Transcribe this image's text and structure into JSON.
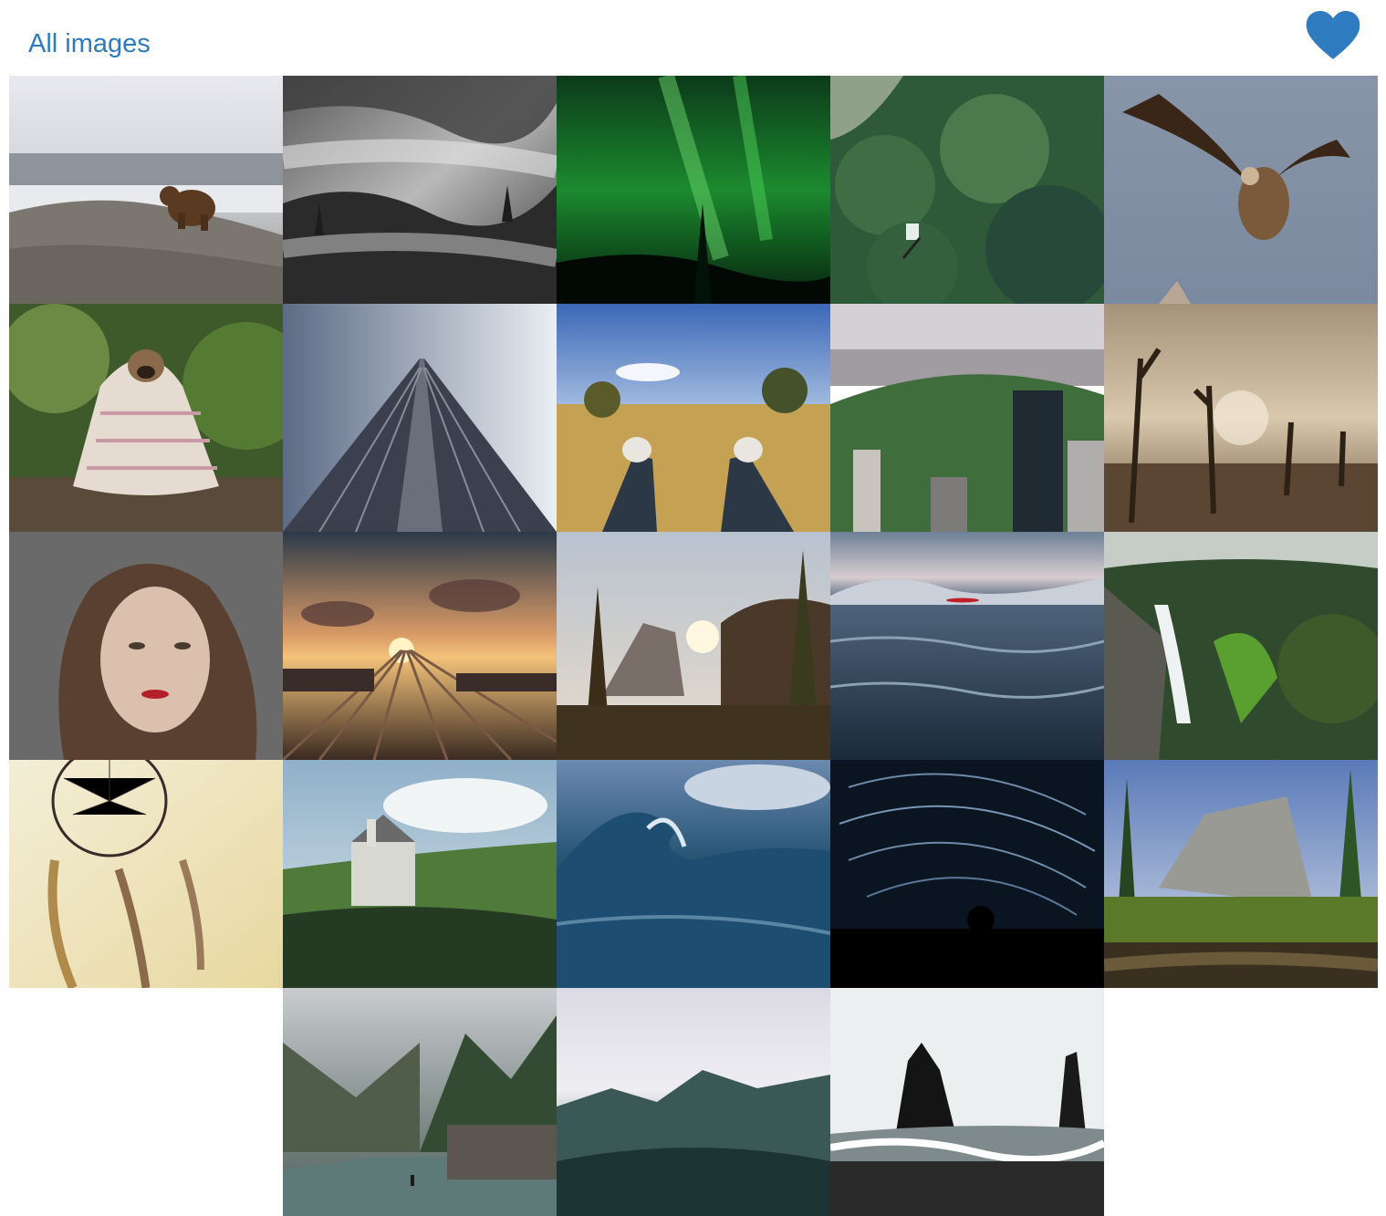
{
  "header": {
    "title": "All images",
    "favorites_icon": "heart-icon"
  },
  "colors": {
    "accent": "#2f7bc0",
    "background": "#ffffff"
  },
  "gallery": {
    "columns": 5,
    "rows": 5,
    "images": [
      {
        "subject": "bear",
        "row": 1,
        "col": 1
      },
      {
        "subject": "foggy-forest",
        "row": 1,
        "col": 2
      },
      {
        "subject": "aurora",
        "row": 1,
        "col": 3
      },
      {
        "subject": "mountain-biker",
        "row": 1,
        "col": 4
      },
      {
        "subject": "vulture",
        "row": 1,
        "col": 5
      },
      {
        "subject": "pug-in-blanket",
        "row": 2,
        "col": 1
      },
      {
        "subject": "skyscraper",
        "row": 2,
        "col": 2
      },
      {
        "subject": "sneakers-field",
        "row": 2,
        "col": 3
      },
      {
        "subject": "central-park",
        "row": 2,
        "col": 4
      },
      {
        "subject": "dead-trees",
        "row": 2,
        "col": 5
      },
      {
        "subject": "woman-portrait",
        "row": 3,
        "col": 1
      },
      {
        "subject": "rail-yard-sunset",
        "row": 3,
        "col": 2
      },
      {
        "subject": "half-dome-sunrise",
        "row": 3,
        "col": 3
      },
      {
        "subject": "lake-kayak",
        "row": 3,
        "col": 4
      },
      {
        "subject": "waterfall",
        "row": 3,
        "col": 5
      },
      {
        "subject": "dreamcatcher",
        "row": 4,
        "col": 1
      },
      {
        "subject": "castle",
        "row": 4,
        "col": 2
      },
      {
        "subject": "ocean-wave",
        "row": 4,
        "col": 3
      },
      {
        "subject": "star-trails",
        "row": 4,
        "col": 4
      },
      {
        "subject": "yosemite-valley",
        "row": 4,
        "col": 5
      },
      {
        "subject": "misty-river",
        "row": 5,
        "col": 2
      },
      {
        "subject": "cloudy-mountains",
        "row": 5,
        "col": 3
      },
      {
        "subject": "sea-stacks",
        "row": 5,
        "col": 4
      }
    ]
  }
}
